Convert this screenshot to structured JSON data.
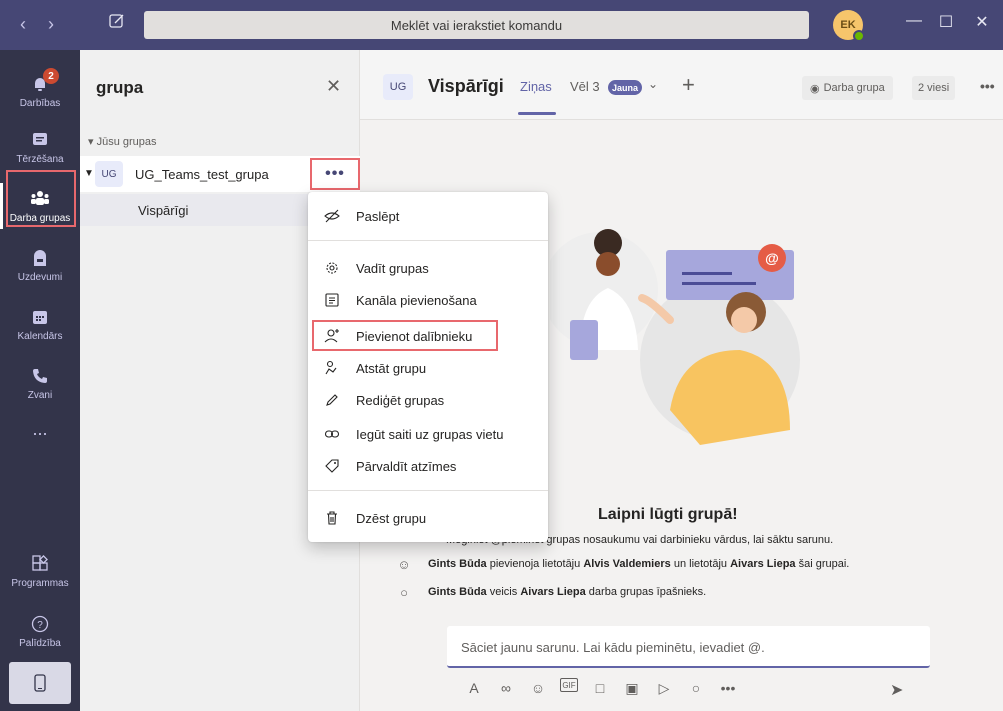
{
  "titlebar": {
    "search_placeholder": "Meklēt vai ierakstiet komandu",
    "user_initials": "EK"
  },
  "rail": {
    "items": [
      {
        "label": "Darbības",
        "badge": "2"
      },
      {
        "label": "Tērzēšana"
      },
      {
        "label": "Darba grupas"
      },
      {
        "label": "Uzdevumi"
      },
      {
        "label": "Kalendārs"
      },
      {
        "label": "Zvani"
      },
      {
        "label": "..."
      },
      {
        "label": "Programmas"
      },
      {
        "label": "Palīdzība"
      }
    ]
  },
  "panel": {
    "title": "grupa",
    "section": "Jūsu grupas",
    "team": {
      "initials": "UG",
      "name": "UG_Teams_test_grupa"
    },
    "channel": "Vispārīgi"
  },
  "header": {
    "initials": "UG",
    "channel": "Vispārīgi",
    "tab_active": "Ziņas",
    "tab_more": "Vēl 3",
    "new_pill": "Jauna",
    "team_button": "Darba grupa",
    "guests_button": "2 viesi"
  },
  "menu": {
    "items": [
      {
        "label": "Paslēpt",
        "icon": "eye-off-icon"
      },
      {
        "label": "Vadīt grupas",
        "icon": "gear-icon"
      },
      {
        "label": "Kanāla pievienošana",
        "icon": "add-channel-icon"
      },
      {
        "label": "Pievienot dalībnieku",
        "icon": "add-person-icon"
      },
      {
        "label": "Atstāt grupu",
        "icon": "leave-icon"
      },
      {
        "label": "Rediģēt grupas",
        "icon": "pencil-icon"
      },
      {
        "label": "Iegūt saiti uz grupas vietu",
        "icon": "link-icon"
      },
      {
        "label": "Pārvaldīt atzīmes",
        "icon": "tag-icon"
      },
      {
        "label": "Dzēst grupu",
        "icon": "trash-icon"
      }
    ]
  },
  "main": {
    "welcome": "Laipni lūgti grupā!",
    "hint": "Mēģiniet @pieminēt grupas nosaukumu vai darbinieku vārdus, lai sāktu sarunu.",
    "activity1": {
      "actor": "Gints Būda",
      "t1": "pievienoja lietotāju",
      "p1": "Alvis Valdemiers",
      "t2": "un lietotāju",
      "p2": "Aivars Liepa",
      "t3": "šai grupai."
    },
    "activity2": {
      "actor": "Gints Būda",
      "t1": "veicis",
      "p1": "Aivars Liepa",
      "t2": "darba grupas īpašnieks."
    },
    "compose_placeholder": "Sāciet jaunu sarunu. Lai kādu pieminētu, ievadiet @."
  }
}
